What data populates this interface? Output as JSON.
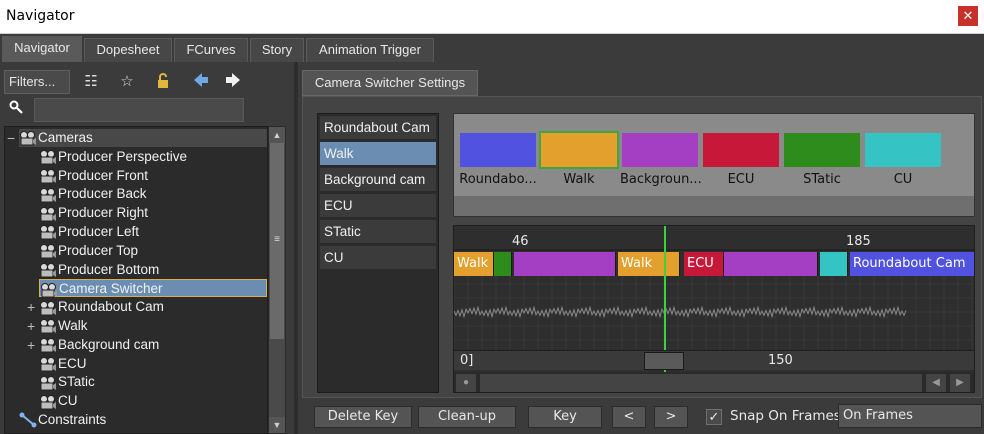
{
  "window": {
    "title": "Navigator",
    "close_glyph": "✕"
  },
  "tabs": [
    {
      "label": "Navigator",
      "active": true
    },
    {
      "label": "Dopesheet",
      "active": false
    },
    {
      "label": "FCurves",
      "active": false
    },
    {
      "label": "Story",
      "active": false
    },
    {
      "label": "Animation Trigger",
      "active": false
    }
  ],
  "left_toolbar": {
    "filters_label": "Filters...",
    "icons": [
      "list-view-icon",
      "select-star-icon",
      "lock-icon",
      "back-arrow-icon",
      "forward-arrow-icon"
    ]
  },
  "search": {
    "value": "",
    "placeholder": ""
  },
  "tree": {
    "items": [
      {
        "label": "Cameras",
        "level": 0,
        "expander": "−",
        "icon": "camera-group-icon"
      },
      {
        "label": "Producer Perspective",
        "level": 1,
        "icon": "camera-icon"
      },
      {
        "label": "Producer Front",
        "level": 1,
        "icon": "camera-icon"
      },
      {
        "label": "Producer Back",
        "level": 1,
        "icon": "camera-icon"
      },
      {
        "label": "Producer Right",
        "level": 1,
        "icon": "camera-icon"
      },
      {
        "label": "Producer Left",
        "level": 1,
        "icon": "camera-icon"
      },
      {
        "label": "Producer Top",
        "level": 1,
        "icon": "camera-icon"
      },
      {
        "label": "Producer Bottom",
        "level": 1,
        "icon": "camera-icon"
      },
      {
        "label": "Camera Switcher",
        "level": 1,
        "icon": "camera-icon",
        "selected": true
      },
      {
        "label": "Roundabout Cam",
        "level": 1,
        "expander": "+",
        "icon": "camera-icon"
      },
      {
        "label": "Walk",
        "level": 1,
        "expander": "+",
        "icon": "camera-icon"
      },
      {
        "label": "Background cam",
        "level": 1,
        "expander": "+",
        "icon": "camera-icon"
      },
      {
        "label": "ECU",
        "level": 1,
        "icon": "camera-icon"
      },
      {
        "label": "STatic",
        "level": 1,
        "icon": "camera-icon"
      },
      {
        "label": "CU",
        "level": 1,
        "icon": "camera-icon"
      },
      {
        "label": "Constraints",
        "level": 0,
        "icon": "constraints-icon"
      }
    ]
  },
  "settings": {
    "tab_label": "Camera Switcher Settings",
    "camera_list": [
      {
        "label": "Roundabout Cam",
        "selected": false
      },
      {
        "label": "Walk",
        "selected": true
      },
      {
        "label": "Background cam",
        "selected": false
      },
      {
        "label": "ECU",
        "selected": false
      },
      {
        "label": "STatic",
        "selected": false
      },
      {
        "label": "CU",
        "selected": false
      }
    ],
    "swatches": [
      {
        "label": "Roundabo...",
        "color": "#5252e0",
        "selected": false
      },
      {
        "label": "Walk",
        "color": "#e3a02c",
        "selected": true
      },
      {
        "label": "Backgroun...",
        "color": "#a43fc3",
        "selected": false
      },
      {
        "label": "ECU",
        "color": "#c8183a",
        "selected": false
      },
      {
        "label": "STatic",
        "color": "#2e8c1c",
        "selected": false
      },
      {
        "label": "CU",
        "color": "#35c3c3",
        "selected": false
      }
    ],
    "timeline": {
      "top_ticks": [
        "46",
        "185"
      ],
      "segments": [
        {
          "label": "Walk",
          "color": "#e3a02c"
        },
        {
          "label": "",
          "color": "#2e8c1c"
        },
        {
          "label": "",
          "color": "#a43fc3"
        },
        {
          "label": "Walk",
          "color": "#e3a02c"
        },
        {
          "label": "ECU",
          "color": "#c8183a"
        },
        {
          "label": "",
          "color": "#a43fc3"
        },
        {
          "label": "",
          "color": "#35c3c3"
        },
        {
          "label": "Roundabout Cam",
          "color": "#5252e0"
        }
      ],
      "bottom_ticks": [
        "0]",
        "150"
      ]
    }
  },
  "bottom_bar": {
    "delete_key": "Delete Key",
    "cleanup": "Clean-up",
    "key": "Key",
    "prev": "<",
    "next": ">",
    "snap_label": "Snap On Frames",
    "snap_checked": true,
    "snap_mode": "On Frames"
  }
}
